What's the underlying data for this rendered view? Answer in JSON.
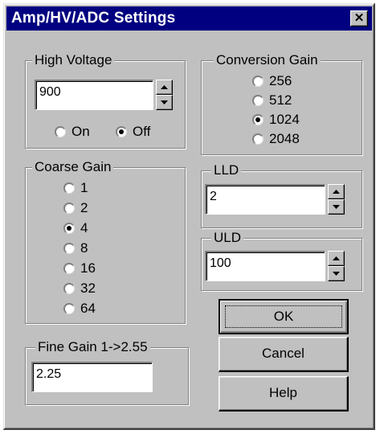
{
  "dialog": {
    "title": "Amp/HV/ADC Settings",
    "close_icon": "close-icon"
  },
  "high_voltage": {
    "label": "High Voltage",
    "value": "900",
    "options": [
      {
        "label": "On",
        "checked": false
      },
      {
        "label": "Off",
        "checked": true
      }
    ]
  },
  "conversion_gain": {
    "label": "Conversion Gain",
    "options": [
      {
        "label": "256",
        "checked": false
      },
      {
        "label": "512",
        "checked": false
      },
      {
        "label": "1024",
        "checked": true
      },
      {
        "label": "2048",
        "checked": false
      }
    ]
  },
  "coarse_gain": {
    "label": "Coarse Gain",
    "options": [
      {
        "label": "1",
        "checked": false
      },
      {
        "label": "2",
        "checked": false
      },
      {
        "label": "4",
        "checked": true
      },
      {
        "label": "8",
        "checked": false
      },
      {
        "label": "16",
        "checked": false
      },
      {
        "label": "32",
        "checked": false
      },
      {
        "label": "64",
        "checked": false
      }
    ]
  },
  "lld": {
    "label": "LLD",
    "value": "2"
  },
  "uld": {
    "label": "ULD",
    "value": "100"
  },
  "fine_gain": {
    "label": "Fine Gain 1->2.55",
    "value": "2.25"
  },
  "buttons": {
    "ok": "OK",
    "cancel": "Cancel",
    "help": "Help"
  }
}
